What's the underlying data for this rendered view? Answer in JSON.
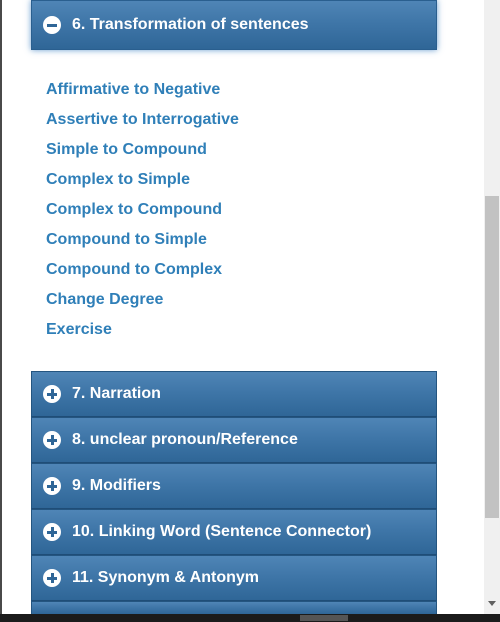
{
  "open_section": {
    "title": "6. Transformation of sentences",
    "toggle": "minus-icon",
    "topics": [
      "Affirmative to Negative",
      "Assertive to Interrogative",
      "Simple to Compound",
      "Complex to Simple",
      "Complex to Compound",
      "Compound to Simple",
      "Compound to Complex",
      "Change Degree",
      "Exercise"
    ]
  },
  "closed_sections": [
    {
      "title": "7. Narration",
      "toggle": "plus-icon"
    },
    {
      "title": "8. unclear pronoun/Reference",
      "toggle": "plus-icon"
    },
    {
      "title": "9. Modifiers",
      "toggle": "plus-icon"
    },
    {
      "title": "10. Linking Word (Sentence Connector)",
      "toggle": "plus-icon"
    },
    {
      "title": "11. Synonym & Antonym",
      "toggle": "plus-icon"
    }
  ],
  "colors": {
    "header_gradient_top": "#4f85b6",
    "header_gradient_bottom": "#2f6697",
    "link": "#2f7fb8"
  }
}
